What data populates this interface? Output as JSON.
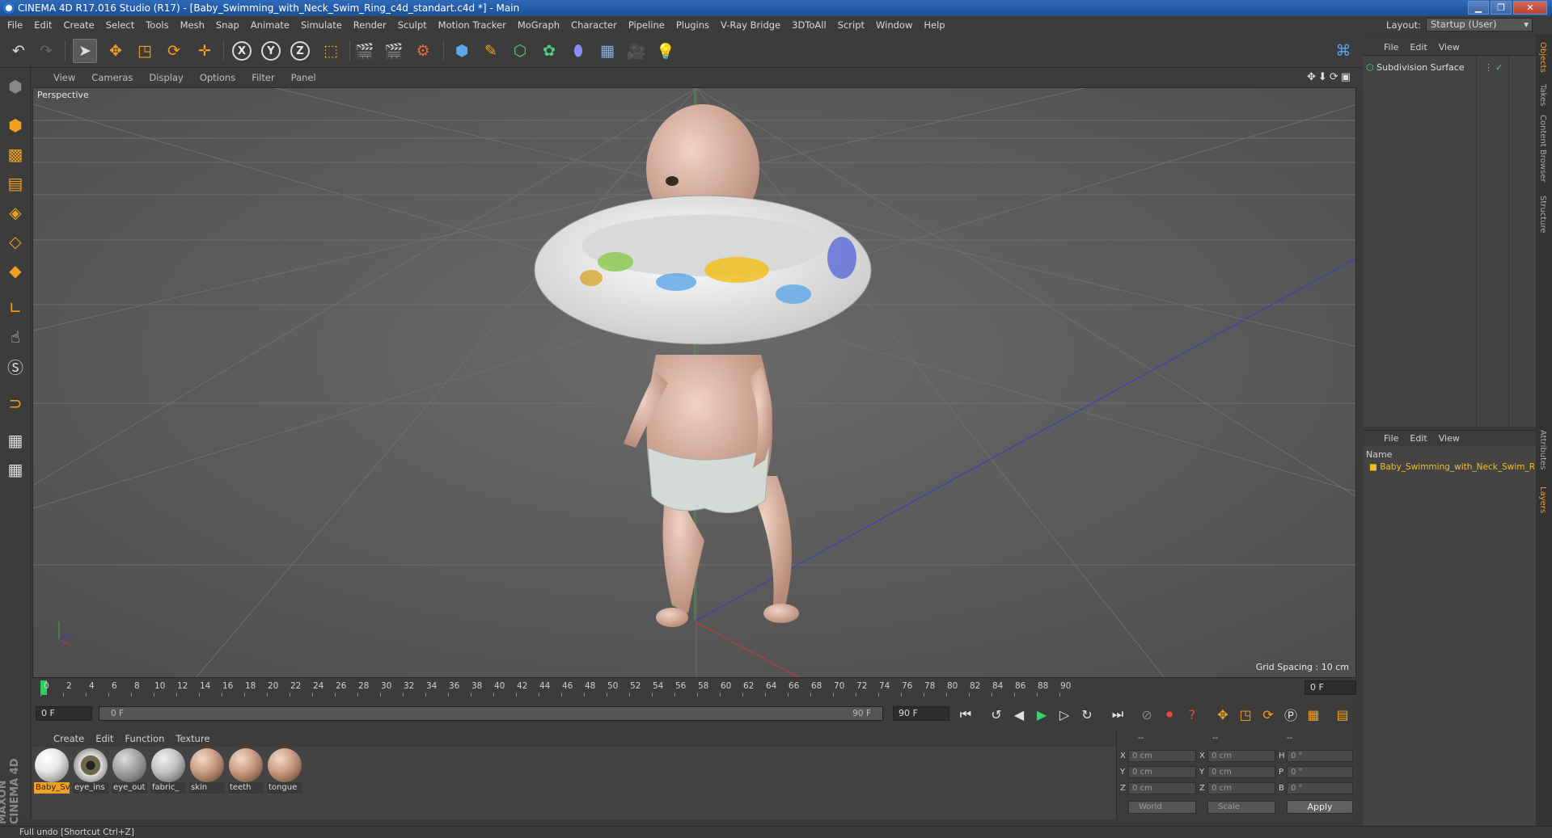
{
  "window": {
    "title": "CINEMA 4D R17.016 Studio (R17) - [Baby_Swimming_with_Neck_Swim_Ring_c4d_standart.c4d *] - Main"
  },
  "menu": [
    "File",
    "Edit",
    "Create",
    "Select",
    "Tools",
    "Mesh",
    "Snap",
    "Animate",
    "Simulate",
    "Render",
    "Sculpt",
    "Motion Tracker",
    "MoGraph",
    "Character",
    "Pipeline",
    "Plugins",
    "V-Ray Bridge",
    "3DToAll",
    "Script",
    "Window",
    "Help"
  ],
  "layout": {
    "label": "Layout:",
    "value": "Startup (User)"
  },
  "toolbar": {
    "x": "X",
    "y": "Y",
    "z": "Z"
  },
  "viewport": {
    "menu": [
      "View",
      "Cameras",
      "Display",
      "Options",
      "Filter",
      "Panel"
    ],
    "camera_label": "Perspective",
    "grid_spacing": "Grid Spacing : 10 cm"
  },
  "timeline": {
    "ticks": [
      "0",
      "2",
      "4",
      "6",
      "8",
      "10",
      "12",
      "14",
      "16",
      "18",
      "20",
      "22",
      "24",
      "26",
      "28",
      "30",
      "32",
      "34",
      "36",
      "38",
      "40",
      "42",
      "44",
      "46",
      "48",
      "50",
      "52",
      "54",
      "56",
      "58",
      "60",
      "62",
      "64",
      "66",
      "68",
      "70",
      "72",
      "74",
      "76",
      "78",
      "80",
      "82",
      "84",
      "86",
      "88",
      "90"
    ],
    "current_frame": "0 F",
    "start_field": "0 F",
    "range_start": "0 F",
    "range_end": "90 F",
    "end_field": "90 F"
  },
  "materials": {
    "menu": [
      "Create",
      "Edit",
      "Function",
      "Texture"
    ],
    "items": [
      {
        "label": "Baby_Sv",
        "selected": true,
        "color": "#e8e8e8"
      },
      {
        "label": "eye_ins",
        "selected": false,
        "color": "#6a6a4a"
      },
      {
        "label": "eye_out",
        "selected": false,
        "color": "#9a9a9a"
      },
      {
        "label": "fabric_",
        "selected": false,
        "color": "#c0c0c0"
      },
      {
        "label": "skin",
        "selected": false,
        "color": "#c79a80"
      },
      {
        "label": "teeth",
        "selected": false,
        "color": "#c79a80"
      },
      {
        "label": "tongue",
        "selected": false,
        "color": "#c79a80"
      }
    ]
  },
  "coords": {
    "header": [
      "--",
      "--",
      "--"
    ],
    "rows": [
      {
        "a": "X",
        "av": "0 cm",
        "b": "X",
        "bv": "0 cm",
        "c": "H",
        "cv": "0 °"
      },
      {
        "a": "Y",
        "av": "0 cm",
        "b": "Y",
        "bv": "0 cm",
        "c": "P",
        "cv": "0 °"
      },
      {
        "a": "Z",
        "av": "0 cm",
        "b": "Z",
        "bv": "0 cm",
        "c": "B",
        "cv": "0 °"
      }
    ],
    "mode": "World",
    "transform": "Scale",
    "apply": "Apply"
  },
  "object_manager": {
    "menu": [
      "File",
      "Edit",
      "View"
    ],
    "object": "Subdivision Surface"
  },
  "layer_manager": {
    "menu": [
      "File",
      "Edit",
      "View"
    ],
    "header": "Name",
    "layer": "Baby_Swimming_with_Neck_Swim_Ring"
  },
  "side_tabs": [
    "Objects",
    "Takes",
    "Content Browser",
    "Structure",
    "Attributes",
    "Layers"
  ],
  "branding": "MAXON CINEMA 4D",
  "status": "Full undo [Shortcut Ctrl+Z]"
}
